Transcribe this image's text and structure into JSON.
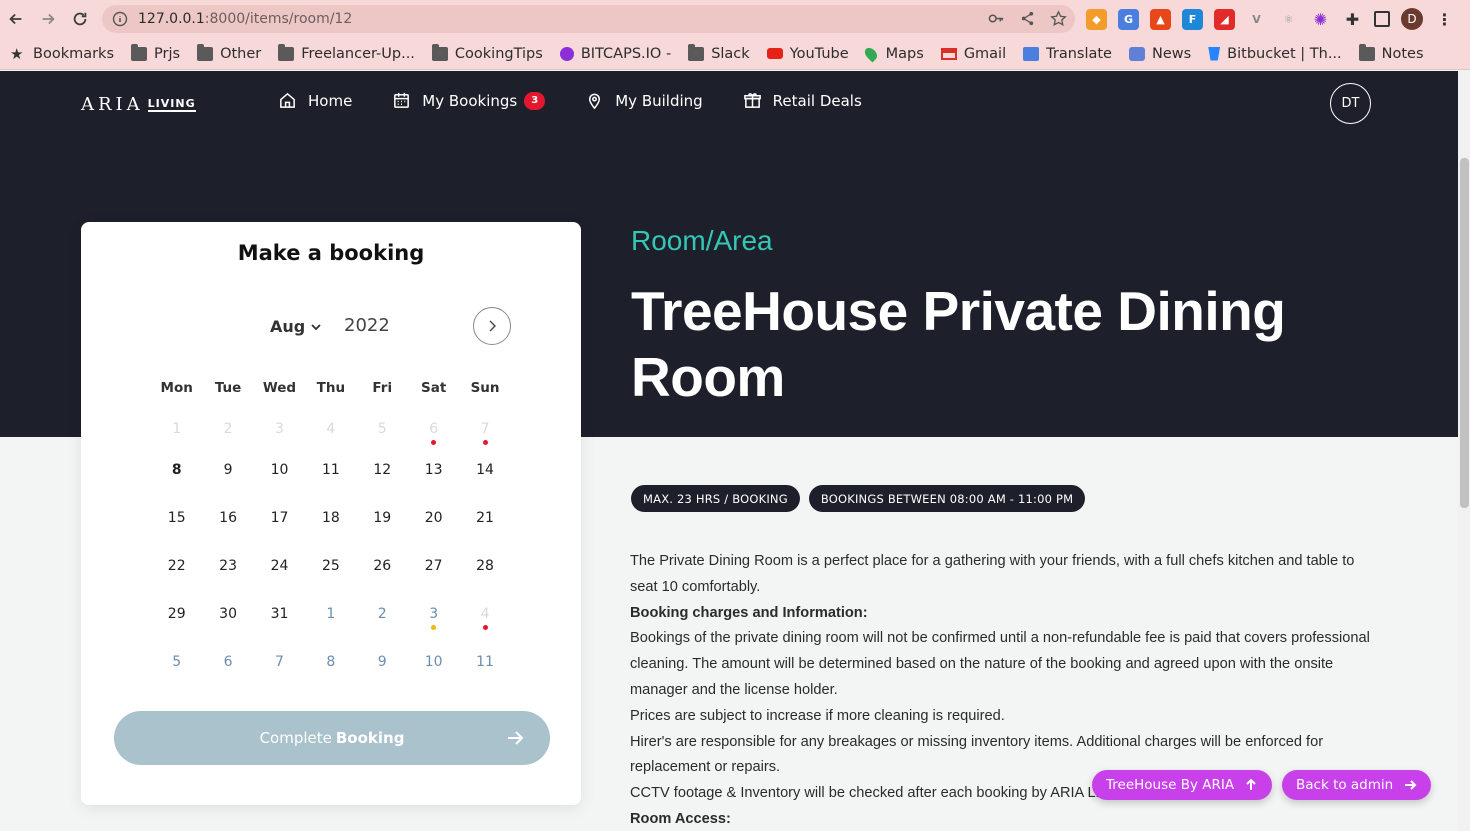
{
  "browser": {
    "url_host": "127.0.0.1",
    "url_rest": ":8000/items/room/12",
    "bookmarks": [
      "Bookmarks",
      "Prjs",
      "Other",
      "Freelancer-Up...",
      "CookingTips",
      "BITCAPS.IO -",
      "Slack",
      "YouTube",
      "Maps",
      "Gmail",
      "Translate",
      "News",
      "Bitbucket | Th...",
      "Notes"
    ],
    "profile_initial": "D"
  },
  "site": {
    "logo_text": "ARIA",
    "logo_sub": "LIVING",
    "nav": {
      "home": "Home",
      "bookings": "My Bookings",
      "bookings_count": "3",
      "building": "My Building",
      "deals": "Retail Deals"
    },
    "avatar": "DT"
  },
  "room": {
    "eyebrow": "Room/Area",
    "title": "TreeHouse Private Dining Room",
    "pills": [
      "MAX. 23 HRS / BOOKING",
      "BOOKINGS BETWEEN 08:00 AM - 11:00 PM"
    ],
    "description": [
      "The Private Dining Room is a perfect place for a gathering with your friends, with a full chefs kitchen and table to seat 10 comfortably.",
      "Booking charges and Information:",
      "Bookings of the private dining room will not be confirmed until a non-refundable fee is paid that covers professional cleaning. The amount will be determined based on the nature of the booking and agreed upon with the onsite manager and the license holder.",
      "Prices are subject to increase if more cleaning is required.",
      "Hirer's are responsible for any breakages or missing inventory items. Additional charges will be enforced for replacement or repairs.",
      "CCTV footage & Inventory will be checked after each booking by ARIA Living.",
      "Room Access:"
    ]
  },
  "booking": {
    "title": "Make a booking",
    "month": "Aug",
    "year": "2022",
    "weekdays": [
      "Mon",
      "Tue",
      "Wed",
      "Thu",
      "Fri",
      "Sat",
      "Sun"
    ],
    "weeks": [
      [
        {
          "d": "1",
          "s": "past"
        },
        {
          "d": "2",
          "s": "past"
        },
        {
          "d": "3",
          "s": "past"
        },
        {
          "d": "4",
          "s": "past"
        },
        {
          "d": "5",
          "s": "past"
        },
        {
          "d": "6",
          "s": "past",
          "dot": "red"
        },
        {
          "d": "7",
          "s": "past",
          "dot": "red"
        }
      ],
      [
        {
          "d": "8",
          "s": "today"
        },
        {
          "d": "9"
        },
        {
          "d": "10"
        },
        {
          "d": "11"
        },
        {
          "d": "12"
        },
        {
          "d": "13"
        },
        {
          "d": "14"
        }
      ],
      [
        {
          "d": "15"
        },
        {
          "d": "16"
        },
        {
          "d": "17"
        },
        {
          "d": "18"
        },
        {
          "d": "19"
        },
        {
          "d": "20"
        },
        {
          "d": "21"
        }
      ],
      [
        {
          "d": "22"
        },
        {
          "d": "23"
        },
        {
          "d": "24"
        },
        {
          "d": "25"
        },
        {
          "d": "26"
        },
        {
          "d": "27"
        },
        {
          "d": "28"
        }
      ],
      [
        {
          "d": "29"
        },
        {
          "d": "30"
        },
        {
          "d": "31"
        },
        {
          "d": "1",
          "s": "next"
        },
        {
          "d": "2",
          "s": "next"
        },
        {
          "d": "3",
          "s": "next",
          "dot": "yellow"
        },
        {
          "d": "4",
          "s": "past",
          "dot": "red"
        }
      ],
      [
        {
          "d": "5",
          "s": "next"
        },
        {
          "d": "6",
          "s": "next"
        },
        {
          "d": "7",
          "s": "next"
        },
        {
          "d": "8",
          "s": "next"
        },
        {
          "d": "9",
          "s": "next"
        },
        {
          "d": "10",
          "s": "next"
        },
        {
          "d": "11",
          "s": "next"
        }
      ]
    ],
    "complete_prefix": "Complete",
    "complete_bold": "Booking"
  },
  "floating": {
    "treehouse": "TreeHouse By ARIA",
    "admin": "Back to admin"
  },
  "colors": {
    "accent_teal": "#34c7b5",
    "hero_bg": "#1d202b",
    "floating_purple": "#c840e9",
    "badge_red": "#e5172f"
  }
}
